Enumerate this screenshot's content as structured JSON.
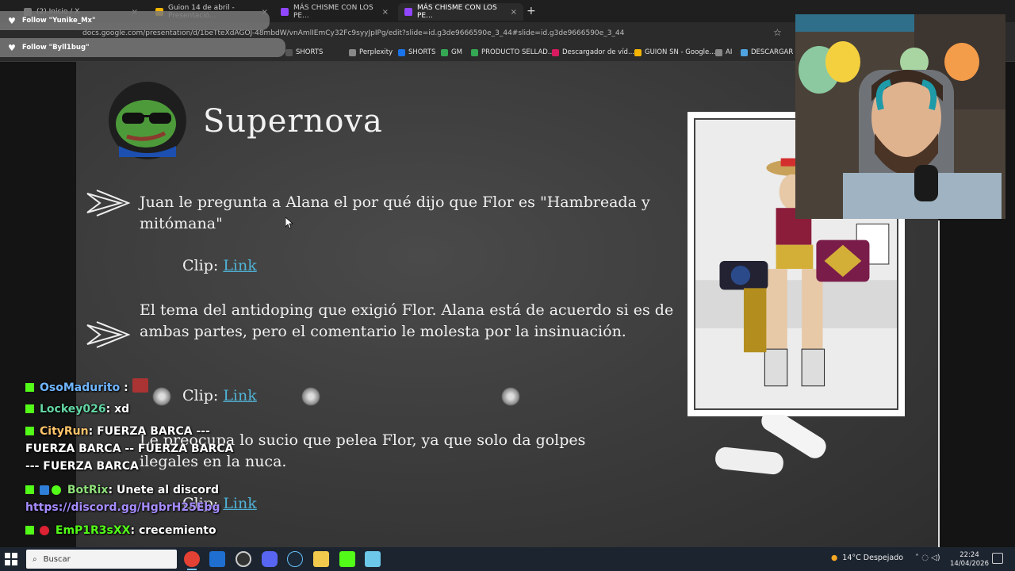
{
  "browser": {
    "tabs": [
      {
        "label": "(2) Inicio / X",
        "close": "×",
        "icon_color": "#777"
      },
      {
        "label": "Guion 14 de abril - Presentació...",
        "close": "×",
        "icon_color": "#f4b400"
      },
      {
        "label": "MÁS CHISME CON LOS PE...",
        "close": "×",
        "icon_color": "#9146ff"
      },
      {
        "label": "MÁS CHISME CON LOS PE...",
        "close": "×",
        "icon_color": "#9146ff"
      }
    ],
    "new_tab": "+",
    "url": "docs.google.com/presentation/d/1beTteXdAGOJ-48mbdW/vnAmlIEmCy32Fc9syyJpIPg/edit?slide=id.g3de9666590e_3_44#slide=id.g3de9666590e_3_44",
    "bookmarks": [
      {
        "label": "SHORTS",
        "icon_color": "#555"
      },
      {
        "label": "Perplexity",
        "icon_color": "#888"
      },
      {
        "label": "SHORTS",
        "icon_color": "#1a73e8"
      },
      {
        "label": "GM",
        "icon_color": "#34a853"
      },
      {
        "label": "PRODUCTO SELLAD...",
        "icon_color": "#34a853"
      },
      {
        "label": "Descargador de víd...",
        "icon_color": "#d81b60"
      },
      {
        "label": "GUION SN - Google...",
        "icon_color": "#f4b400"
      },
      {
        "label": "AI",
        "icon_color": "#888"
      },
      {
        "label": "DESCARGAR TV",
        "icon_color": "#4fa3e0"
      }
    ]
  },
  "alerts": [
    {
      "text": "Follow \"Yunike_Mx\""
    },
    {
      "text": "Follow \"Byll1bug\""
    }
  ],
  "slide": {
    "title": "Supernova",
    "items": [
      {
        "text": "Juan le pregunta a Alana el por qué dijo que Flor es \"Hambreada y mitómana\"",
        "clip_label": "Clip:",
        "clip_link": "Link"
      },
      {
        "text": "El tema del antidoping que exigió Flor. Alana está de acuerdo si es de ambas partes, pero el comentario le molesta por la insinuación.",
        "clip_label": "Clip:",
        "clip_link": "Link"
      },
      {
        "text": "Le preocupa lo sucio que pelea Flor, ya que solo da golpes ilegales en la nuca.",
        "clip_label": "Clip:",
        "clip_link": "Link"
      }
    ]
  },
  "chat": {
    "messages": [
      {
        "user": "OsoMadurito",
        "sep": ":",
        "text": ""
      },
      {
        "user": "Lockey026",
        "sep": ":",
        "text": "xd"
      },
      {
        "user": "CityRun",
        "sep": ":",
        "text": "FUERZA BARCA --- FUERZA BARCA -- FUERZA BARCA --- FUERZA BARCA"
      },
      {
        "user": "BotRix",
        "sep": ":",
        "text": "Unete al discord",
        "link": "https://discord.gg/HgbrH25Ebg"
      },
      {
        "user": "EmP1R3sXX",
        "sep": ":",
        "text": "crecemiento"
      }
    ]
  },
  "taskbar": {
    "search_placeholder": "Buscar",
    "weather": "14°C  Despejado",
    "time": "22:24",
    "date": "14/04/2026"
  },
  "colors": {
    "kick_green": "#53fc18",
    "link_blue": "#4fb3d6",
    "taskbar": "#1c2430"
  }
}
